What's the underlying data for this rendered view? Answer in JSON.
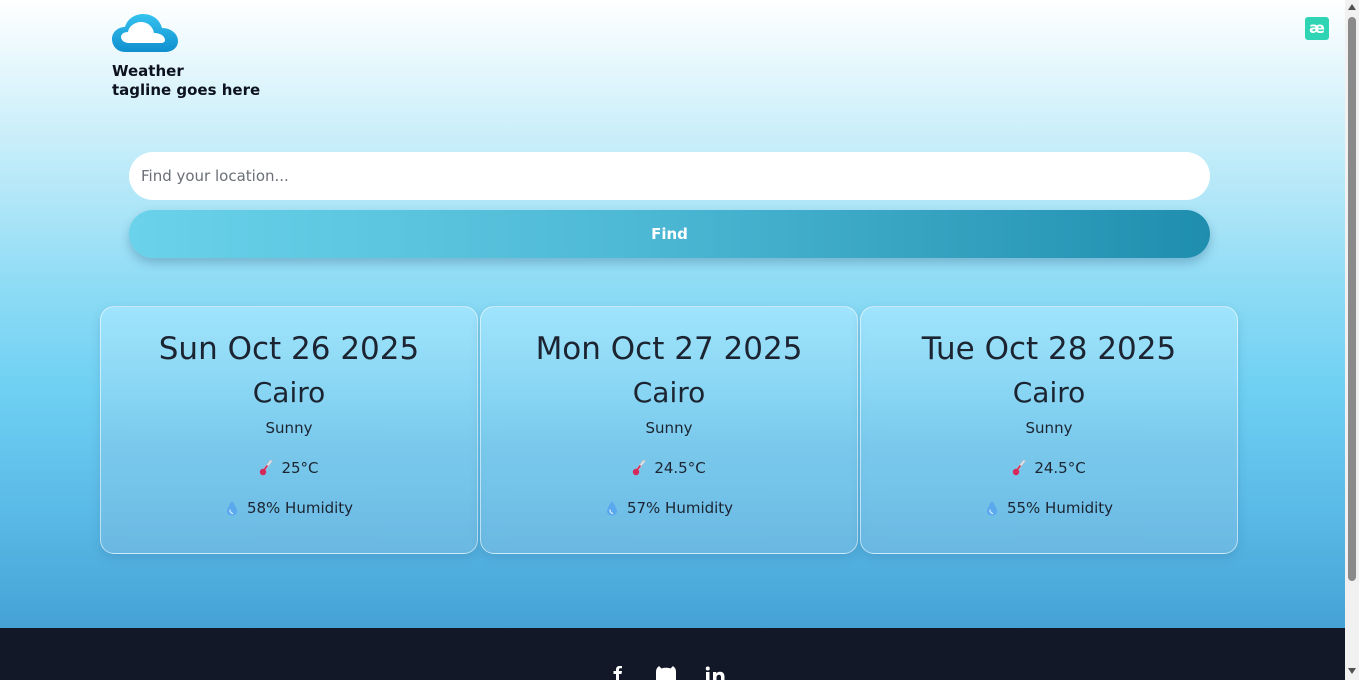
{
  "brand": {
    "name": "Weather",
    "tagline": "tagline goes here",
    "logo_icon": "cloud-icon"
  },
  "extension_badge": "æ",
  "search": {
    "placeholder": "Find your location...",
    "value": "",
    "button_label": "Find"
  },
  "forecast": [
    {
      "date": "Sun Oct 26 2025",
      "city": "Cairo",
      "condition": "Sunny",
      "temperature": "25°C",
      "humidity": "58% Humidity"
    },
    {
      "date": "Mon Oct 27 2025",
      "city": "Cairo",
      "condition": "Sunny",
      "temperature": "24.5°C",
      "humidity": "57% Humidity"
    },
    {
      "date": "Tue Oct 28 2025",
      "city": "Cairo",
      "condition": "Sunny",
      "temperature": "24.5°C",
      "humidity": "55% Humidity"
    }
  ],
  "footer": {
    "social_icons": [
      "facebook-icon",
      "github-icon",
      "linkedin-icon"
    ]
  },
  "colors": {
    "footer_bg": "#121827",
    "accent": "#1f8eae",
    "text": "#1b2430"
  }
}
